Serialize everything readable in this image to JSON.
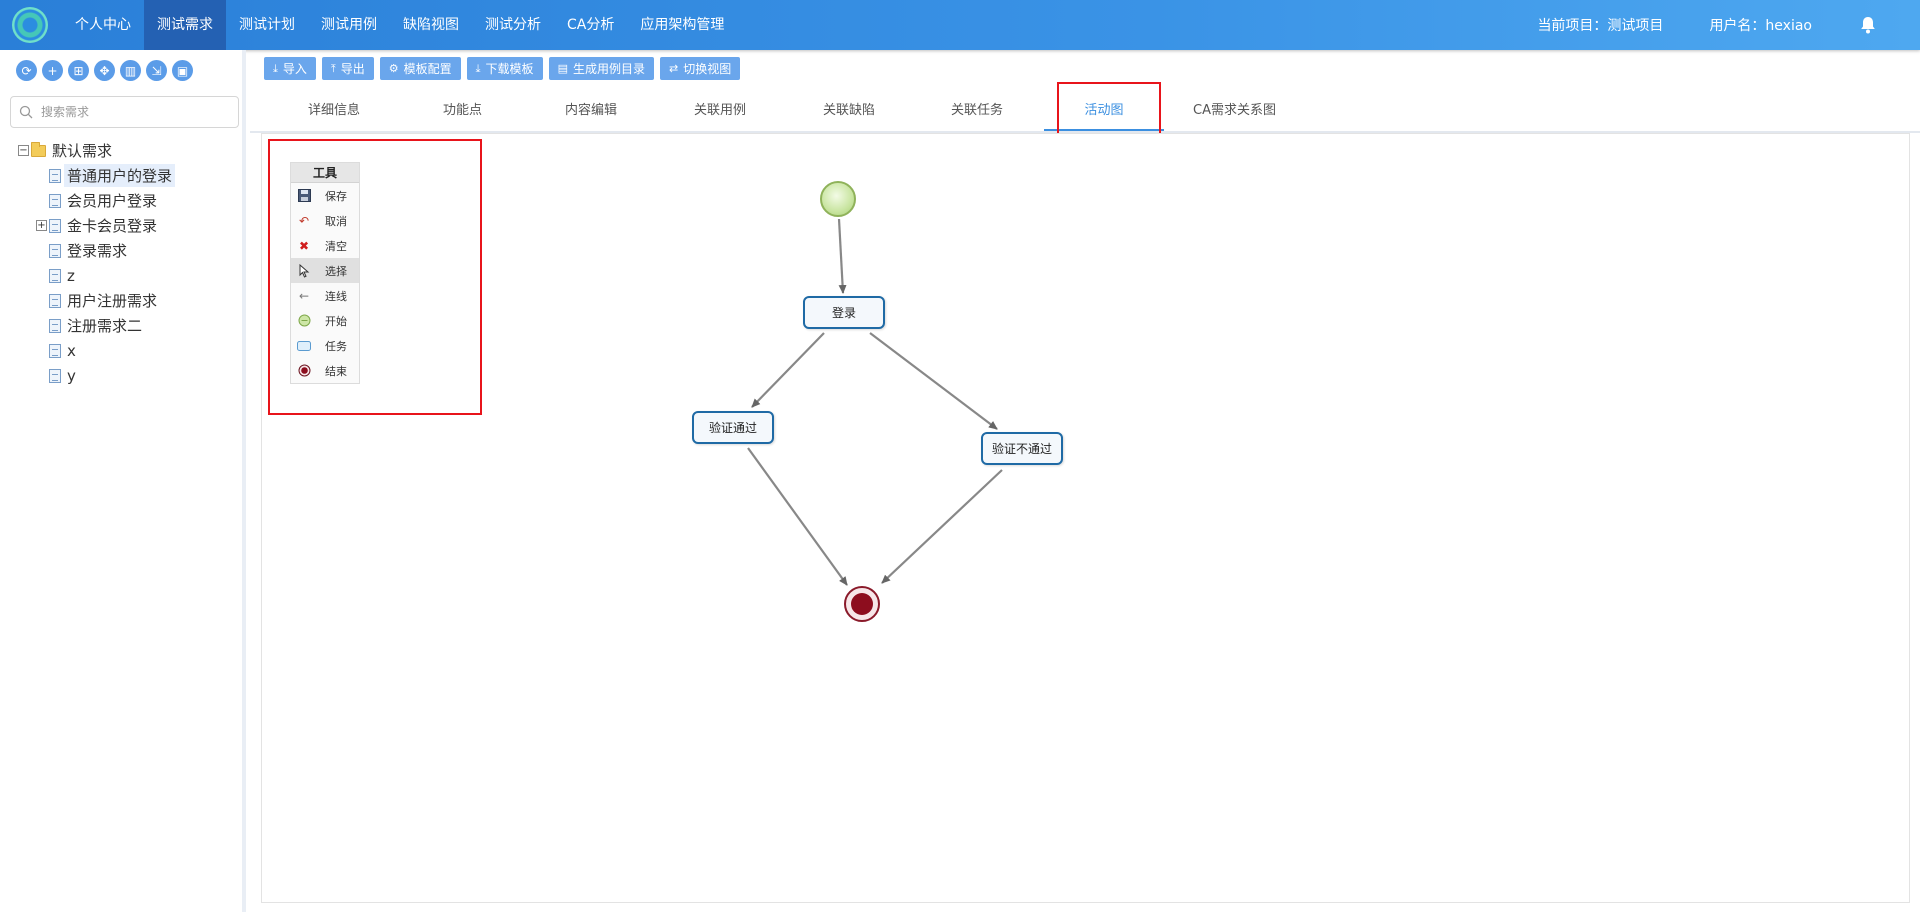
{
  "nav": {
    "items": [
      "个人中心",
      "测试需求",
      "测试计划",
      "测试用例",
      "缺陷视图",
      "测试分析",
      "CA分析",
      "应用架构管理"
    ],
    "active_index": 1,
    "current_project": "当前项目：测试项目",
    "username": "用户名：hexiao"
  },
  "sidebar": {
    "search_placeholder": "搜索需求",
    "tree": {
      "root": "默认需求",
      "children": [
        "普通用户的登录",
        "会员用户登录",
        "金卡会员登录",
        "登录需求",
        "z",
        "用户注册需求",
        "注册需求二",
        "x",
        "y"
      ],
      "selected": "普通用户的登录"
    }
  },
  "toolbar": {
    "buttons": [
      "导入",
      "导出",
      "模板配置",
      "下载模板",
      "生成用例目录",
      "切换视图"
    ]
  },
  "tabs": {
    "items": [
      "详细信息",
      "功能点",
      "内容编辑",
      "关联用例",
      "关联缺陷",
      "关联任务",
      "活动图",
      "CA需求关系图"
    ],
    "active": "活动图"
  },
  "toolpanel": {
    "title": "工具",
    "items": [
      "保存",
      "取消",
      "清空",
      "选择",
      "连线",
      "开始",
      "任务",
      "结束"
    ],
    "selected": "选择"
  },
  "diagram": {
    "tasks": [
      "登录",
      "验证通过",
      "验证不通过"
    ]
  },
  "colors": {
    "topbar": "#2a7fd8",
    "active_nav": "#2461b3",
    "button": "#6aa6ec",
    "active_tab": "#3b8fe0",
    "highlight_box": "#e8141b",
    "task_border": "#1f6aa5",
    "end_node": "#8d0d1e"
  }
}
